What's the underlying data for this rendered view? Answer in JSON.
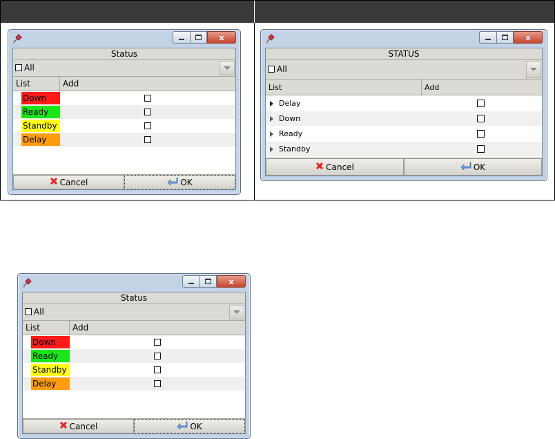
{
  "comparison": {
    "left_header": "",
    "right_header": ""
  },
  "window_controls": {
    "close_glyph": "x"
  },
  "dialog_colored": {
    "title": "Status",
    "all_label": "All",
    "columns": [
      "List",
      "Add"
    ],
    "items": [
      {
        "label": "Down",
        "color": "#ff1a1a"
      },
      {
        "label": "Ready",
        "color": "#19e619"
      },
      {
        "label": "Standby",
        "color": "#ffff1a"
      },
      {
        "label": "Delay",
        "color": "#ff9c12"
      }
    ],
    "cancel_label": "Cancel",
    "ok_label": "OK"
  },
  "dialog_tree": {
    "title": "STATUS",
    "all_label": "All",
    "columns": [
      "List",
      "Add"
    ],
    "items": [
      {
        "label": "Delay",
        "expanded_marker": "filled"
      },
      {
        "label": "Down",
        "expanded_marker": "hollow"
      },
      {
        "label": "Ready",
        "expanded_marker": "hollow"
      },
      {
        "label": "Standby",
        "expanded_marker": "hollow"
      }
    ],
    "cancel_label": "Cancel",
    "ok_label": "OK"
  },
  "colors": {
    "header_bar": "#3a3a3a",
    "window_frame": "#c3d3e6",
    "panel_bg": "#dcdad5"
  }
}
